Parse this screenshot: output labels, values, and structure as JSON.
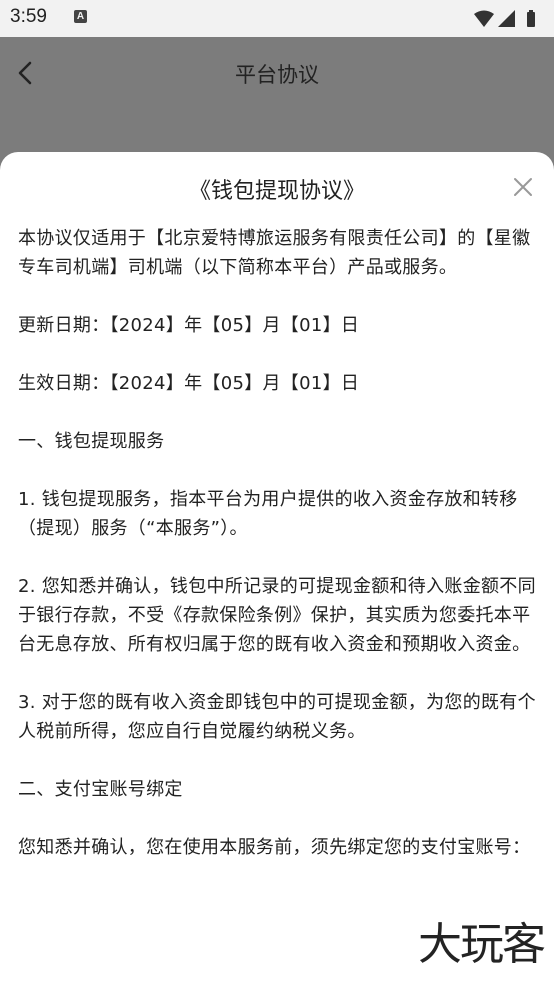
{
  "status_bar": {
    "time": "3:59",
    "notification_icon": "A",
    "icons": [
      "wifi-icon",
      "signal-icon",
      "battery-icon"
    ]
  },
  "nav": {
    "title": "平台协议",
    "back_icon": "chevron-left-icon"
  },
  "dialog": {
    "title": "《钱包提现协议》",
    "close_icon": "close-icon",
    "paragraphs": [
      "本协议仅适用于【北京爱特博旅运服务有限责任公司】的【星徽专车司机端】司机端（以下简称本平台）产品或服务。",
      "更新日期：【2024】年【05】月【01】日",
      "生效日期：【2024】年【05】月【01】日",
      "一、钱包提现服务",
      "1. 钱包提现服务，指本平台为用户提供的收入资金存放和转移（提现）服务（“本服务”）。",
      "2. 您知悉并确认，钱包中所记录的可提现金额和待入账金额不同于银行存款，不受《存款保险条例》保护，其实质为您委托本平台无息存放、所有权归属于您的既有收入资金和预期收入资金。",
      "3. 对于您的既有收入资金即钱包中的可提现金额，为您的既有个人税前所得，您应自行自觉履约纳税义务。",
      "二、支付宝账号绑定",
      "您知悉并确认，您在使用本服务前，须先绑定您的支付宝账号："
    ]
  },
  "watermark": "大玩客"
}
